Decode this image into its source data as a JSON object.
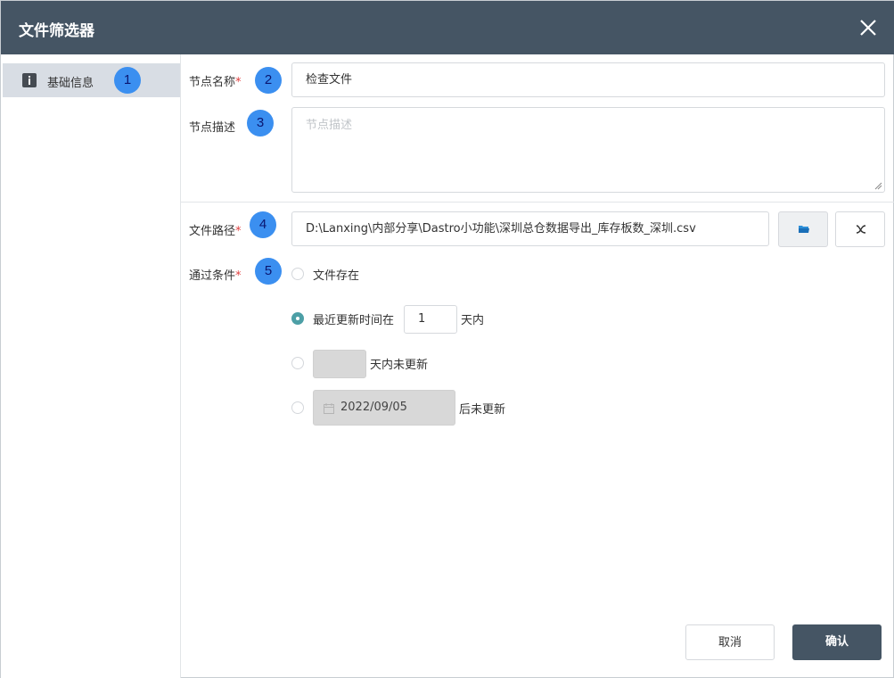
{
  "dialog": {
    "title": "文件筛选器"
  },
  "sidebar": {
    "items": [
      {
        "label": "基础信息",
        "icon": "info-icon",
        "badge": "1"
      }
    ]
  },
  "form": {
    "node_name": {
      "label": "节点名称",
      "required_mark": "*",
      "value": "检查文件",
      "badge": "2"
    },
    "node_desc": {
      "label": "节点描述",
      "placeholder": "节点描述",
      "badge": "3"
    },
    "file_path": {
      "label": "文件路径",
      "required_mark": "*",
      "value": "D:\\Lanxing\\内部分享\\Dastro小功能\\深圳总仓数据导出_库存板数_深圳.csv",
      "badge": "4",
      "browse_icon": "folder-icon",
      "variable_icon": "function-x-icon"
    },
    "pass_condition": {
      "label": "通过条件",
      "required_mark": "*",
      "badge": "5",
      "options": {
        "file_exists": {
          "label": "文件存在",
          "checked": false
        },
        "recent_update": {
          "prefix": "最近更新时间在",
          "days_value": "1",
          "suffix": "天内",
          "checked": true
        },
        "not_updated_days": {
          "suffix": "天内未更新",
          "checked": false
        },
        "not_updated_after": {
          "date": "2022/09/05",
          "suffix": "后未更新",
          "checked": false
        }
      }
    }
  },
  "footer": {
    "cancel_label": "取消",
    "confirm_label": "确认"
  },
  "colors": {
    "titlebar": "#455564",
    "badge": "#3b8ff0",
    "radio_checked": "#4d9fa6",
    "required": "#e04040"
  }
}
